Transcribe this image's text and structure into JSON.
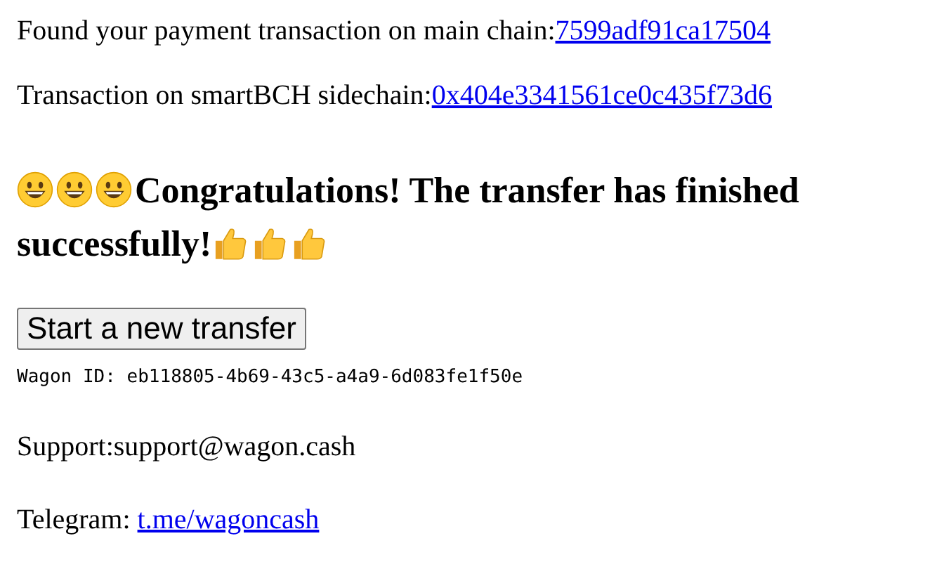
{
  "main_chain": {
    "label": "Found your payment transaction on main chain:",
    "link": "7599adf91ca17504"
  },
  "sidechain": {
    "label": "Transaction on smartBCH sidechain:",
    "link": "0x404e3341561ce0c435f73d6"
  },
  "heading_lines": [
    [
      {
        "kind": "grinning-face"
      },
      {
        "kind": "grinning-face"
      },
      {
        "kind": "grinning-face"
      },
      {
        "kind": "text",
        "text": "Congratulations! The transfer has finished"
      }
    ],
    [
      {
        "kind": "text",
        "text": "successfully!"
      },
      {
        "kind": "thumbs-up"
      },
      {
        "kind": "thumbs-up"
      },
      {
        "kind": "thumbs-up"
      }
    ]
  ],
  "new_transfer_button": "Start a new transfer",
  "wagon_id": "Wagon ID: eb118805-4b69-43c5-a4a9-6d083fe1f50e",
  "support": "Support:support@wagon.cash",
  "telegram": {
    "label": "Telegram:",
    "link": "t.me/wagoncash"
  }
}
